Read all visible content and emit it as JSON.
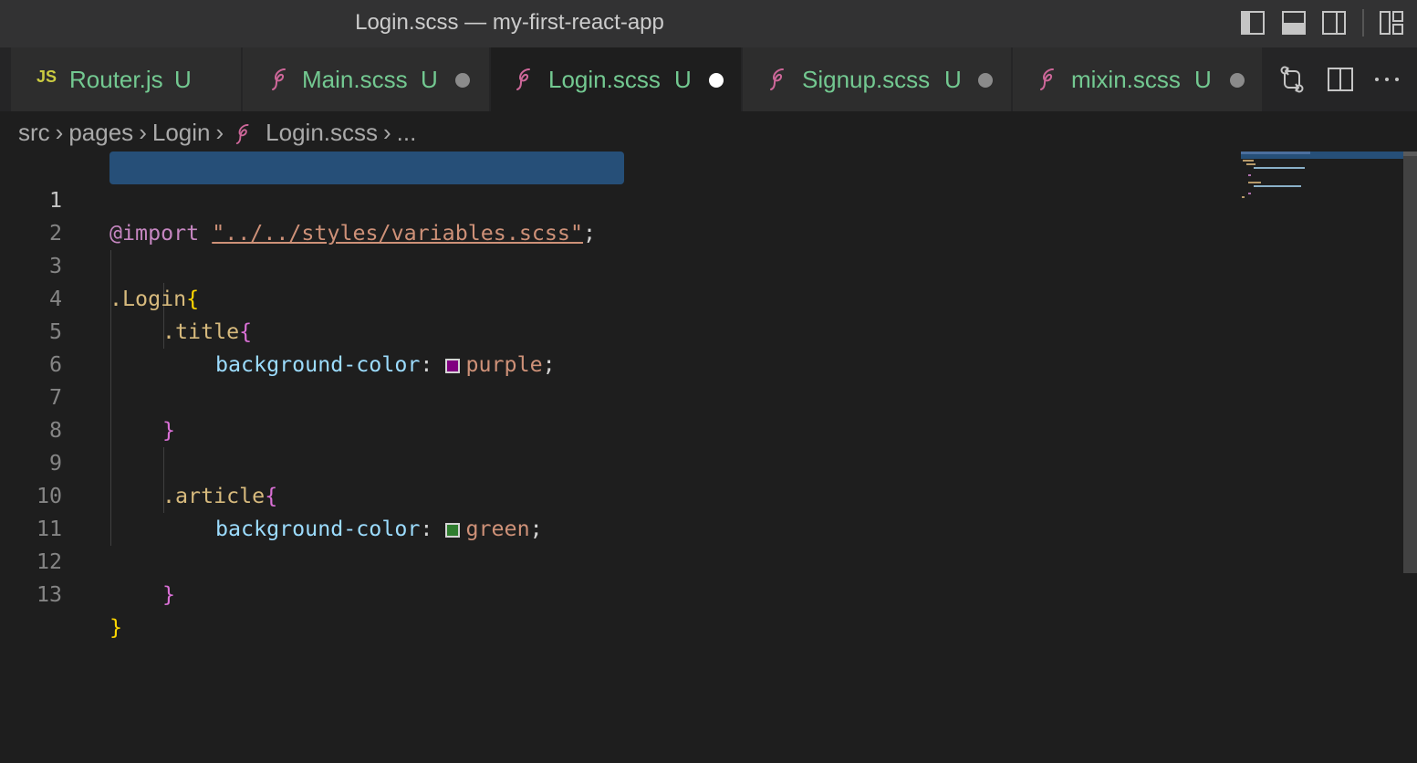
{
  "window": {
    "title": "Login.scss — my-first-react-app"
  },
  "tabs": [
    {
      "icon": "JS",
      "name": "Router.js",
      "status": "U",
      "modified": false,
      "active": false
    },
    {
      "icon": "sass-icon",
      "name": "Main.scss",
      "status": "U",
      "modified": true,
      "active": false
    },
    {
      "icon": "sass-icon",
      "name": "Login.scss",
      "status": "U",
      "modified": true,
      "active": true
    },
    {
      "icon": "sass-icon",
      "name": "Signup.scss",
      "status": "U",
      "modified": true,
      "active": false
    },
    {
      "icon": "sass-icon",
      "name": "mixin.scss",
      "status": "U",
      "modified": true,
      "active": false
    }
  ],
  "breadcrumb": {
    "items": [
      "src",
      "pages",
      "Login",
      "Login.scss",
      "..."
    ]
  },
  "editor": {
    "line_numbers": [
      "1",
      "2",
      "3",
      "4",
      "5",
      "6",
      "7",
      "8",
      "9",
      "10",
      "11",
      "12",
      "13"
    ],
    "l1": {
      "at": "@import",
      "space": " ",
      "str": "\"../../styles/variables.scss\"",
      "semi": ";"
    },
    "l3": {
      "sel": ".Login",
      "brace": "{"
    },
    "l4": {
      "sel": ".title",
      "brace": "{"
    },
    "l5": {
      "prop": "background-color",
      "colon": ": ",
      "val": "purple",
      "semi": ";"
    },
    "l7": {
      "brace": "}"
    },
    "l9": {
      "sel": ".article",
      "brace": "{"
    },
    "l10": {
      "prop": "background-color",
      "colon": ": ",
      "val": "green",
      "semi": ";"
    },
    "l12": {
      "brace": "}"
    },
    "l13": {
      "brace": "}"
    }
  },
  "colors": {
    "purple_swatch": "#800080",
    "green_swatch": "#008000",
    "git_untracked": "#73c991",
    "selection": "#264f78"
  }
}
